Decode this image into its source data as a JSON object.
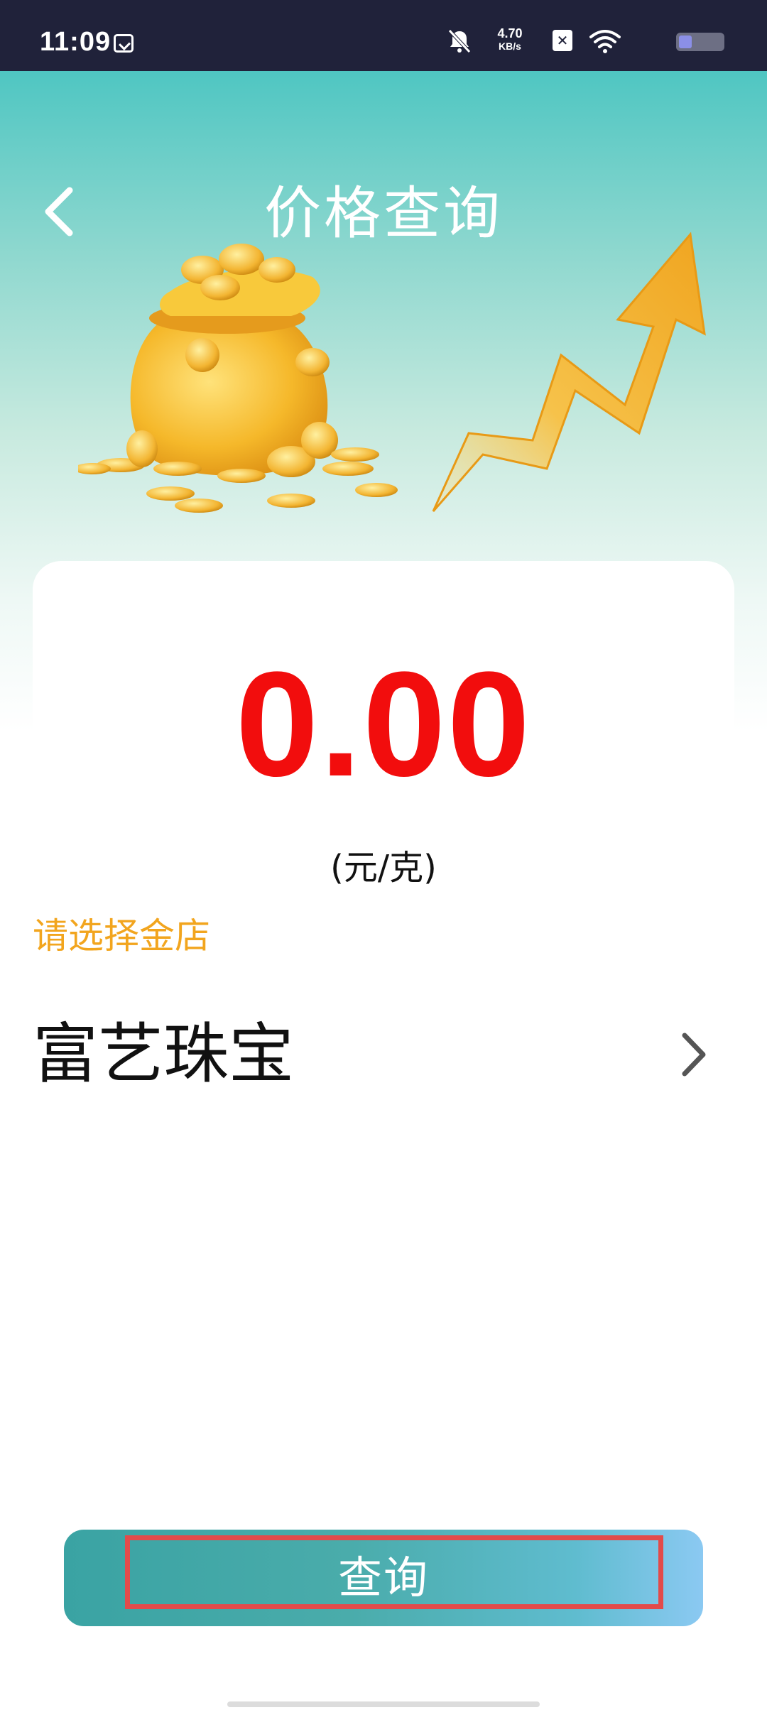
{
  "status_bar": {
    "time": "11:09",
    "net_speed_value": "4.70",
    "net_speed_unit": "KB/s",
    "colors": {
      "background": "#20223a",
      "battery": "#8b8fe7"
    }
  },
  "header": {
    "title": "价格查询",
    "back_icon": "back-arrow-icon"
  },
  "price": {
    "value": "0.00",
    "unit": "(元/克)",
    "color": "#f20d0d"
  },
  "store": {
    "prompt": "请选择金店",
    "selected": "富艺珠宝",
    "prompt_color": "#f2a51e"
  },
  "actions": {
    "query_label": "查询"
  },
  "theme": {
    "accent": "#4fc6c2",
    "button_gradient_start": "#3aa3a3",
    "button_gradient_end": "#8bc9f2",
    "highlight": "#e24b4b"
  }
}
